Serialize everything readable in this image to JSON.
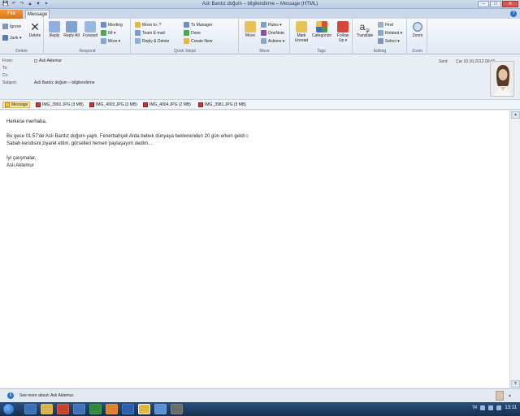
{
  "window": {
    "title": "Aslı Bardız doğum – bilgilendirme – Message (HTML)",
    "min": "–",
    "max": "□",
    "close": "✕"
  },
  "qat": [
    "💾",
    "↶",
    "↷",
    "▲",
    "▼",
    "▾"
  ],
  "tabs": {
    "file": "File",
    "message": "Message",
    "help": "?"
  },
  "ribbon": {
    "delete_group": {
      "label": "Delete",
      "ignore": "Ignore",
      "junk": "Junk ▾",
      "delete": "Delete"
    },
    "respond_group": {
      "label": "Respond",
      "reply": "Reply",
      "reply_all": "Reply All",
      "forward": "Forward",
      "meeting": "Meeting",
      "im": "IM ▾",
      "more": "More ▾"
    },
    "quicksteps_group": {
      "label": "Quick Steps",
      "move_to": "Move to: ?",
      "team_email": "Team E-mail",
      "reply_delete": "Reply & Delete",
      "to_manager": "To Manager",
      "done": "Done",
      "create_new": "Create New"
    },
    "move_group": {
      "label": "Move",
      "move": "Move",
      "rules": "Rules ▾",
      "onenote": "OneNote",
      "actions": "Actions ▾"
    },
    "tags_group": {
      "label": "Tags",
      "mark_unread": "Mark Unread",
      "categorize": "Categorize",
      "follow_up": "Follow Up ▾"
    },
    "editing_group": {
      "label": "Editing",
      "translate": "Translate",
      "find": "Find",
      "related": "Related ▾",
      "select": "Select ▾"
    },
    "zoom_group": {
      "label": "Zoom",
      "zoom": "Zoom"
    }
  },
  "header": {
    "from_label": "From:",
    "from_value": "Aslı Aktemur",
    "to_label": "To:",
    "cc_label": "Cc:",
    "subject_label": "Subject:",
    "subject_value": "Aslı Bardız doğum – bilgilendirme",
    "sent_label": "Sent:",
    "sent_value": "Çar 10.10.2012 09:46"
  },
  "attachments": [
    {
      "name": "Message"
    },
    {
      "name": "IMG_3991.JPG (3 MB)"
    },
    {
      "name": "IMG_4003.JPG (3 MB)"
    },
    {
      "name": "IMG_4004.JPG (2 MB)"
    },
    {
      "name": "IMG_3981.JPG (3 MB)"
    }
  ],
  "body": {
    "greeting": "Herkese merhaba,",
    "line1": "Bu gece 01:57'de Aslı Bardız doğum yaptı, Fenerbahçeli Arda bebek dünyaya beklenenden 20 gün erken geldi☺",
    "line2": "Sabah kendisini ziyaret ettim, görselleri hemen paylaşayım dedim…",
    "closing": "İyi çalışmalar,",
    "signature": "Aslı Aktemur"
  },
  "people_bar": {
    "text": "See more about: Aslı Aktemur.",
    "info": "i",
    "expand": "▴"
  },
  "taskbar": {
    "lang": "TR",
    "time": "13:11"
  },
  "scroll": {
    "up": "▲",
    "down": "▼"
  },
  "colors": {
    "accent_file_tab": "#d97416",
    "ribbon_bg": "#e1e9f3",
    "taskbar_bg": "#15304f"
  }
}
